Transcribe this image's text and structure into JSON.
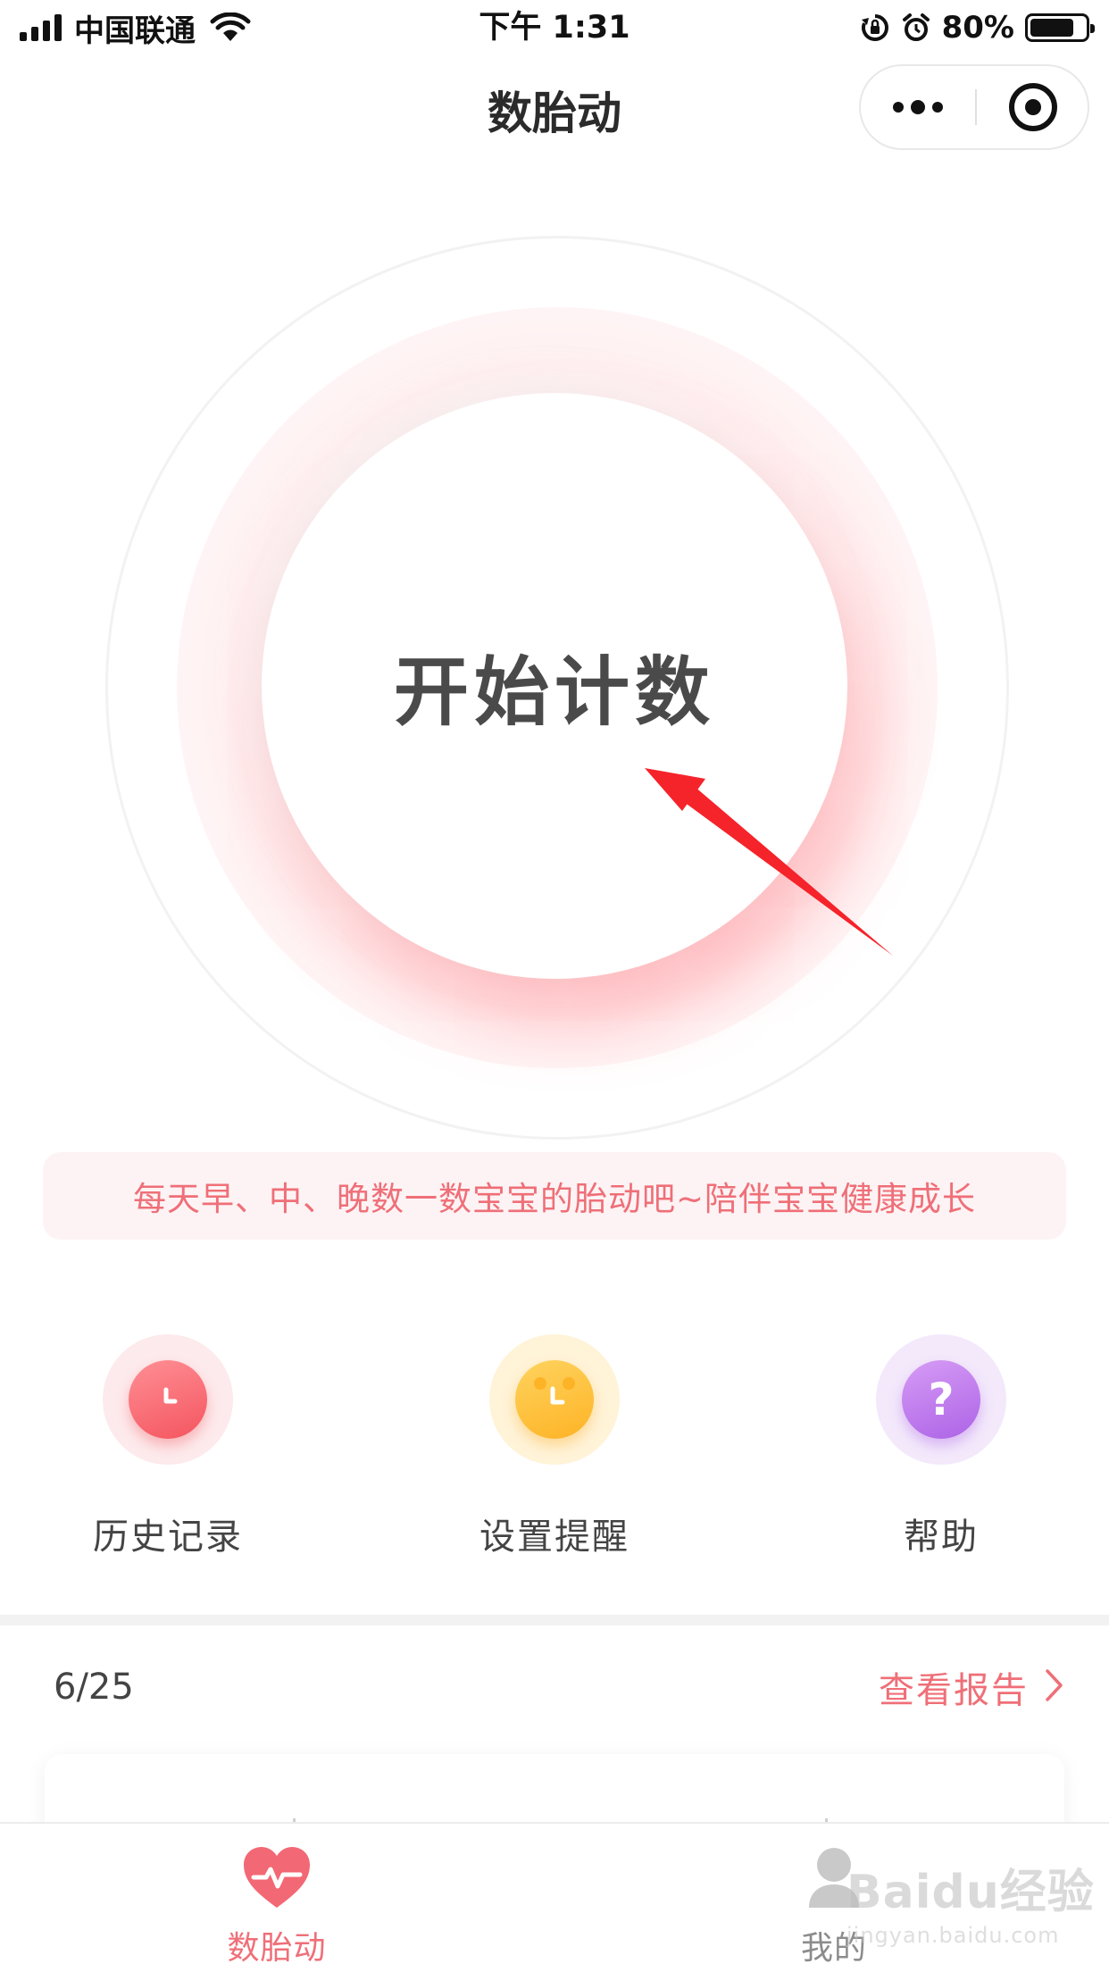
{
  "status_bar": {
    "carrier": "中国联通",
    "time": "下午 1:31",
    "battery_percent": "80%",
    "battery_level": 0.8
  },
  "nav": {
    "title": "数胎动"
  },
  "main": {
    "start_label": "开始计数",
    "tip": "每天早、中、晚数一数宝宝的胎动吧~陪伴宝宝健康成长"
  },
  "shortcuts": [
    {
      "label": "历史记录",
      "icon": "clock-icon",
      "color": "#f4555f"
    },
    {
      "label": "设置提醒",
      "icon": "alarm-clock-icon",
      "color": "#fdb326"
    },
    {
      "label": "帮助",
      "icon": "question-icon",
      "color": "#ad63e6"
    }
  ],
  "summary": {
    "date": "6/25",
    "report_link": "查看报告"
  },
  "tabs": [
    {
      "label": "数胎动",
      "icon": "heart-pulse-icon",
      "active": true
    },
    {
      "label": "我的",
      "icon": "person-icon",
      "active": false
    }
  ],
  "watermark": {
    "brand": "Baidu经验",
    "url": "jingyan.baidu.com"
  },
  "colors": {
    "accent": "#ef6f78",
    "tip_bg": "#fdf3f4",
    "annotation_arrow": "#f5232a"
  }
}
